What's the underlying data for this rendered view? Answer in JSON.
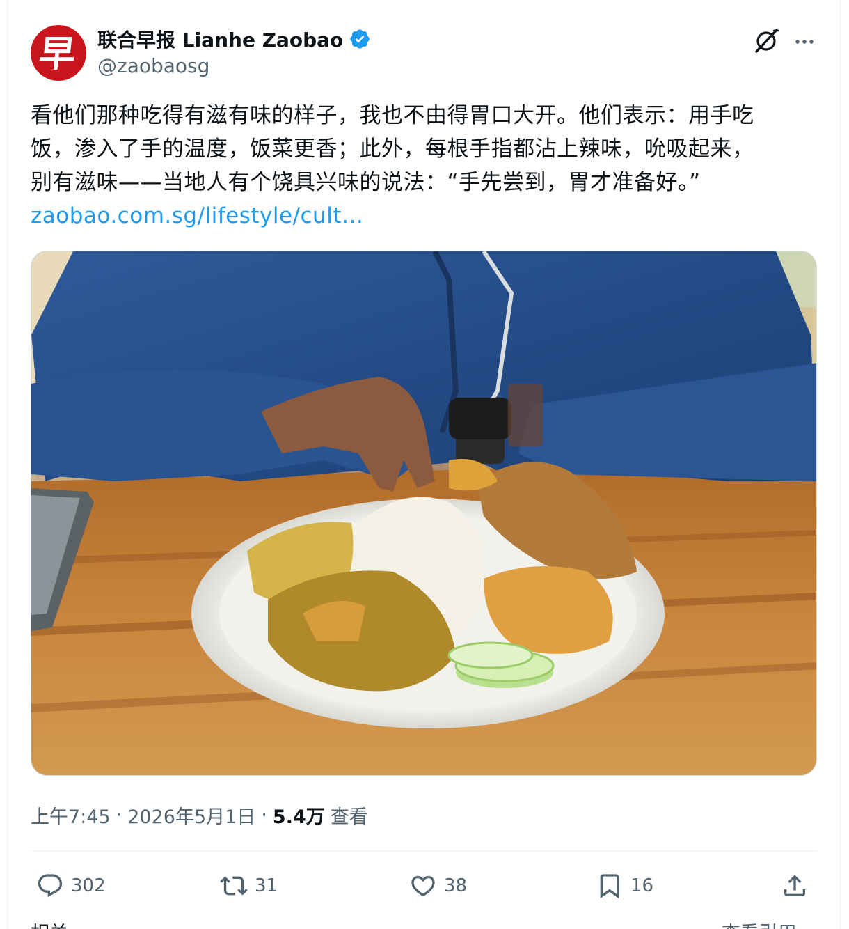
{
  "account": {
    "display_name": "联合早报 Lianhe Zaobao",
    "handle": "@zaobaosg",
    "avatar_glyph": "早",
    "verified": true,
    "brand_color": "#c7161e",
    "verified_color": "#1d9bf0"
  },
  "post": {
    "lines": [
      "看他们那种吃得有滋有味的样子，我也不由得胃口大开。他们表示：用手吃",
      "饭，渗入了手的温度，饭菜更香；此外，每根手指都沾上辣味，吮吸起来，",
      "别有滋味——当地人有个饶具兴味的说法：“手先尝到，胃才准备好。”"
    ],
    "link_text": "zaobao.com.sg/lifestyle/cult…",
    "link_color": "#1d9bf0"
  },
  "media": {
    "subject": "person in blue jacket eating rice and curry by hand"
  },
  "meta": {
    "time": "上午7:45",
    "separator": "·",
    "date": "2026年5月1日",
    "views_count": "5.4万",
    "views_label": "查看"
  },
  "actions": {
    "reply_count": "302",
    "repost_count": "31",
    "like_count": "38",
    "bookmark_count": "16"
  },
  "footer": {
    "related_label": "相关",
    "quotes_label": "查看引用"
  },
  "icons": {
    "grok": "grok-icon",
    "more": "more-icon",
    "reply": "reply-icon",
    "repost": "repost-icon",
    "like": "heart-icon",
    "bookmark": "bookmark-icon",
    "share": "share-icon",
    "verified": "verified-badge-icon"
  }
}
